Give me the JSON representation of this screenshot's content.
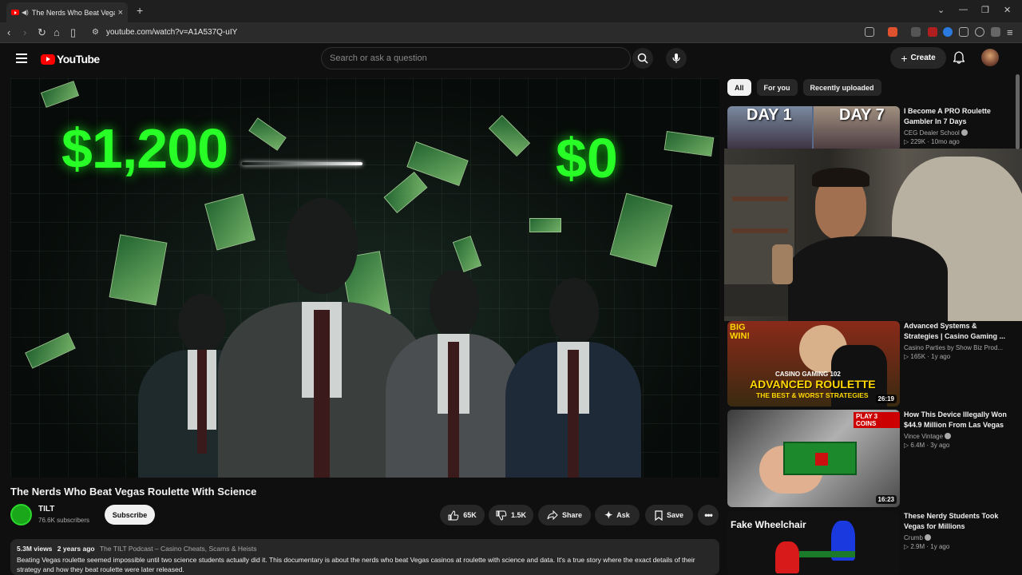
{
  "browser": {
    "tab_title": "The Nerds Who Beat Vegas Ro",
    "url": "youtube.com/watch?v=A1A537Q-uIY"
  },
  "header": {
    "logo_text": "YouTube",
    "search_placeholder": "Search or ask a question",
    "create_label": "Create"
  },
  "video": {
    "overlay_left": "$1,200",
    "overlay_right": "$0",
    "title": "The Nerds Who Beat Vegas Roulette With Science",
    "channel": "TILT",
    "subscribers": "76.6K subscribers",
    "subscribe_label": "Subscribe",
    "likes": "65K",
    "dislikes": "1.5K",
    "share_label": "Share",
    "ask_label": "Ask",
    "save_label": "Save",
    "views": "5.3M views",
    "age": "2 years ago",
    "tags": "The TILT Podcast – Casino Cheats, Scams & Heists",
    "description": "Beating Vegas roulette seemed impossible until two science students actually did it. This documentary is about the nerds who beat Vegas casinos at roulette with science and data. It's a true story where the exact details of their strategy and how they beat roulette were later released."
  },
  "sidebar": {
    "chips": [
      "All",
      "For you",
      "Recently uploaded"
    ],
    "recommendations": [
      {
        "title": "I Become A PRO Roulette Gambler In 7 Days",
        "channel": "CEG Dealer School",
        "views": "229K",
        "age": "10mo ago",
        "thumb_text_left": "DAY 1",
        "thumb_text_right": "DAY 7"
      },
      {
        "title": "Advanced Systems & Strategies | Casino Gaming ...",
        "channel": "Casino Parties by Show Biz Prod...",
        "views": "165K",
        "age": "1y ago",
        "duration": "26:19",
        "thumb_line1": "BIG WIN!",
        "thumb_line2": "CASINO GAMING 102",
        "thumb_line3": "ADVANCED ROULETTE",
        "thumb_line4": "THE BEST & WORST STRATEGIES"
      },
      {
        "title": "How This Device Illegally Won $44.9 Million From Las Vegas",
        "channel": "Vince Vintage",
        "views": "6.4M",
        "age": "3y ago",
        "duration": "16:23",
        "thumb_text": "PLAY 3 COINS"
      },
      {
        "title": "These Nerdy Students Took Vegas for Millions",
        "channel": "Crumb",
        "views": "2.9M",
        "age": "1y ago",
        "thumb_text": "Fake Wheelchair"
      }
    ]
  }
}
